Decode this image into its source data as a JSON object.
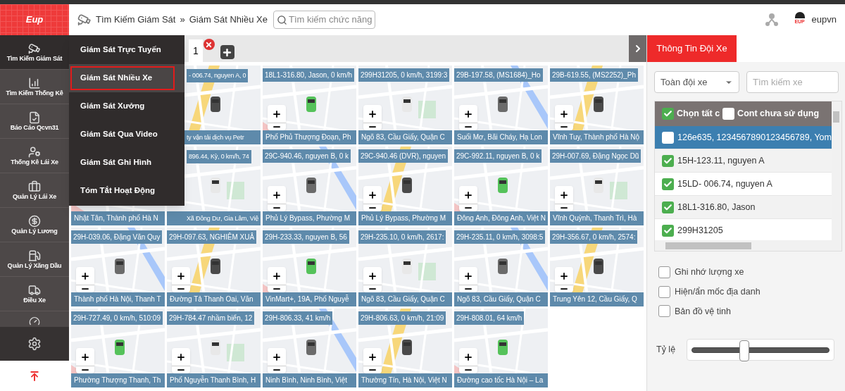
{
  "logo": {
    "text": "Eup"
  },
  "breadcrumb": [
    "Tìm Kiếm Giám Sát",
    "»",
    "Giám Sát Nhiều Xe"
  ],
  "function_search": {
    "label": "Tìm kiếm chức năng"
  },
  "user": {
    "name": "eupvn",
    "avatar_text": "EUP"
  },
  "sidebar": {
    "items": [
      {
        "kind": "camera",
        "label": "Tìm Kiếm Giám Sát",
        "selected": true
      },
      {
        "kind": "chart",
        "label": "Tìm Kiếm Thống Kê",
        "selected": false
      },
      {
        "kind": "report",
        "label": "Báo Cáo Qcvn31",
        "selected": false
      },
      {
        "kind": "driver",
        "label": "Thống Kê Lái Xe",
        "selected": false
      },
      {
        "kind": "briefcase",
        "label": "Quản Lý Lái Xe",
        "selected": false
      },
      {
        "kind": "salary",
        "label": "Quản Lý Lương",
        "selected": false
      },
      {
        "kind": "fuel",
        "label": "Quản Lý Xăng Dầu",
        "selected": false
      },
      {
        "kind": "dispatch",
        "label": "Điều Xe",
        "selected": false
      }
    ]
  },
  "menu": {
    "items": [
      {
        "label": "Giám Sát Trực Tuyến",
        "selected": false
      },
      {
        "label": "Giám Sát Nhiều Xe",
        "selected": true
      },
      {
        "label": "Giám Sát Xưởng",
        "selected": false
      },
      {
        "label": "Giám Sát Qua Video",
        "selected": false
      },
      {
        "label": "Giám Sát Ghi Hình",
        "selected": false
      },
      {
        "label": "Tóm Tắt Hoạt Động",
        "selected": false
      }
    ]
  },
  "tabs": [
    {
      "label": "1",
      "selected": true
    }
  ],
  "map_rows": [
    [
      {},
      {
        "partly_hidden": true,
        "header": "- 006.74, nguyen A, 0",
        "footer": "ty vận tải dịch vụ Petr"
      },
      {
        "header": "18L1-316.80, Jason, 0 km/h",
        "footer": "Phố Phủ Thượng Đoạn, Ph"
      },
      {
        "header": "299H31205, 0 km/h, 3199:3",
        "footer": "Ngõ 83, Cầu Giấy, Quận C"
      },
      {
        "header": "29B-197.58, (MS1684)_Ho",
        "footer": "Suối Mơ, Bãi Cháy, Hạ Lon"
      },
      {
        "header": "29B-619.55, (MS2252)_Ph",
        "footer": "Vĩnh Tuy, Thành phố Hà Nộ"
      }
    ],
    [
      {
        "footer": "Nhật Tân, Thành phố Hà N"
      },
      {
        "partly_hidden": true,
        "header": "896.44, Kỳ, 0 km/h, 74",
        "footer": "Xã Đông Dư, Gia Lâm, Việ"
      },
      {
        "header": "29C-940.46, nguyen B, 0 k",
        "footer": "Phủ Lý Bypass, Phường M"
      },
      {
        "header": "29C-940.46 (DVR), nguyen",
        "footer": "Phủ Lý Bypass, Phường M"
      },
      {
        "header": "29C-992.11, nguyen B, 0 k",
        "footer": "Đông Anh, Đông Anh, Việt N"
      },
      {
        "header": "29H-007.69, Đặng Ngọc Dũ",
        "footer": "Vĩnh Quỳnh, Thanh Trì, Hà"
      }
    ],
    [
      {
        "header": "29H-039.06, Đặng Văn Quy",
        "footer": "Thành phố Hà Nội, Thanh T"
      },
      {
        "header": "29H-097.63, NGHIÊM XUÂ",
        "footer": "Đường Tả Thanh Oai, Văn"
      },
      {
        "header": "29H-233.33, nguyen B, 56",
        "footer": "VinMart+, 19A, Phố Nguyễ"
      },
      {
        "header": "29H-235.10, 0 km/h, 2617:",
        "footer": "Ngõ 83, Cầu Giấy, Quận C"
      },
      {
        "header": "29H-235.11, 0 km/h, 3098:5",
        "footer": "Ngõ 83, Cầu Giấy, Quận C"
      },
      {
        "header": "29H-356.67, 0 km/h, 2574:",
        "footer": "Trung Yên 12, Cầu Giấy, Q"
      }
    ],
    [
      {
        "header": "29H-727.49, 0 km/h, 510:09",
        "footer": "Phường Thượng Thanh, Th"
      },
      {
        "header": "29H-784.47 nhầm biển, 12",
        "footer": "Phố Nguyễn Thanh Bình, H"
      },
      {
        "header": "29H-806.33, 41 km/h",
        "footer": "Ninh Bình, Ninh Bình, Việt"
      },
      {
        "header": "29H-806.63, 0 km/h, 21:09",
        "footer": "Thường Tín, Hà Nội, Việt N"
      },
      {
        "header": "29H-808.01, 64 km/h",
        "footer": "Đường cao tốc Hà Nội – La"
      }
    ]
  ],
  "panel": {
    "title": "Thông Tin Đội Xe",
    "group_select": {
      "value": "Toàn đội xe"
    },
    "vehicle_search": {
      "placeholder": "Tìm kiếm xe"
    },
    "list_header": [
      {
        "label": "Chọn tất c",
        "checked": true
      },
      {
        "label": "Cont chưa sử dụng",
        "checked": false
      }
    ],
    "vehicles": [
      {
        "label": "126e635, 1234567890123456789, Yom",
        "checked": false,
        "selected": true
      },
      {
        "label": "15H-123.11, nguyen A",
        "checked": true,
        "selected": false
      },
      {
        "label": "15LD- 006.74, nguyen A",
        "checked": true,
        "selected": false
      },
      {
        "label": "18L1-316.80, Jason",
        "checked": true,
        "selected": false
      },
      {
        "label": "299H31205",
        "checked": true,
        "selected": false
      }
    ],
    "options": [
      {
        "label": "Ghi nhớ lượng xe",
        "checked": false
      },
      {
        "label": "Hiện/ẩn mốc địa danh",
        "checked": false
      },
      {
        "label": "Bản đồ vệ tinh",
        "checked": false
      }
    ],
    "scale": {
      "label": "Tỷ lệ",
      "level": 0.38
    }
  }
}
